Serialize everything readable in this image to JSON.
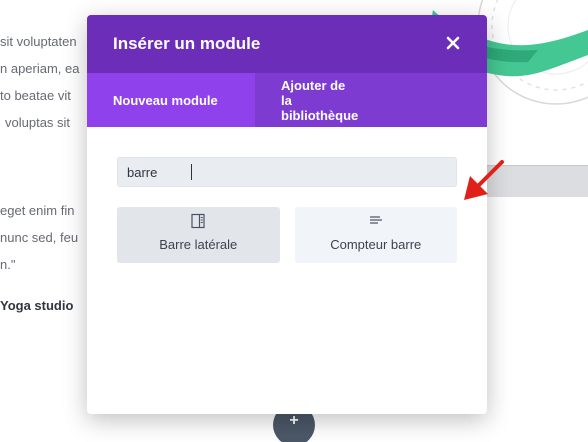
{
  "background": {
    "lines": [
      "sit voluptaten",
      "n aperiam, ea",
      "to beatae vit",
      "voluptas sit",
      "eget enim fin",
      "nunc sed, feu",
      "n.\"",
      "Yoga studio"
    ],
    "fab_symbol": "+"
  },
  "modal": {
    "title": "Insérer un module",
    "close_icon": "close-icon",
    "tabs": [
      {
        "label": "Nouveau module",
        "active": true
      },
      {
        "label": "Ajouter de la bibliothèque",
        "active": false
      }
    ],
    "search": {
      "value": "barre",
      "placeholder": ""
    },
    "modules": [
      {
        "label": "Barre latérale",
        "icon": "sidebar-icon"
      },
      {
        "label": "Compteur barre",
        "icon": "bar-counter-icon"
      }
    ]
  },
  "colors": {
    "header": "#6c2eb9",
    "tabs_bg": "#7d3bd1",
    "tab_active": "#8f42ec",
    "arrow": "#e0201b"
  }
}
